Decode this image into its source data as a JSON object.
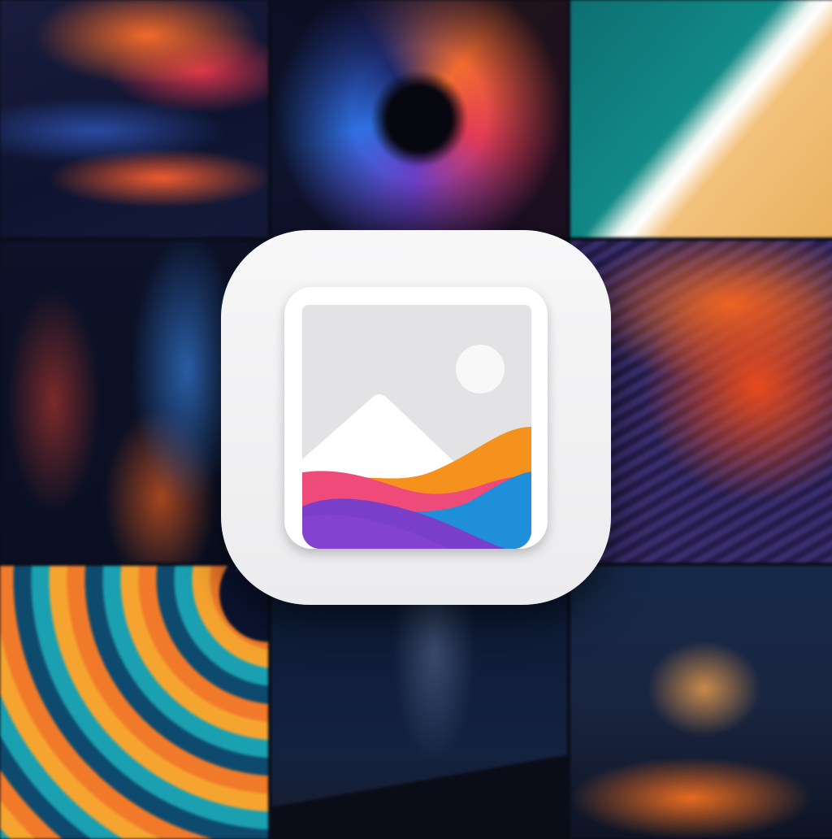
{
  "background_tiles": [
    "abstract-fluid-red-orange",
    "spiral-vortex",
    "beach-aerial",
    "abstract-fluid-dark-blue",
    "abstract-dark",
    "abstract-orange-bubbles-purple-waves",
    "rainbow-swirl",
    "night-sky-milky-way",
    "mountains-stars"
  ],
  "app_icon": {
    "glyph": "photos-icon",
    "colors": {
      "tile": "#F4F4F5",
      "frame": "#FFFFFF",
      "sky": "#E3E3E6",
      "sun": "#F8F8F8",
      "wave_orange": "#F5921E",
      "wave_pink": "#EE4A7A",
      "wave_blue": "#1E8FD8",
      "wave_purple": "#7A3FC8"
    }
  }
}
